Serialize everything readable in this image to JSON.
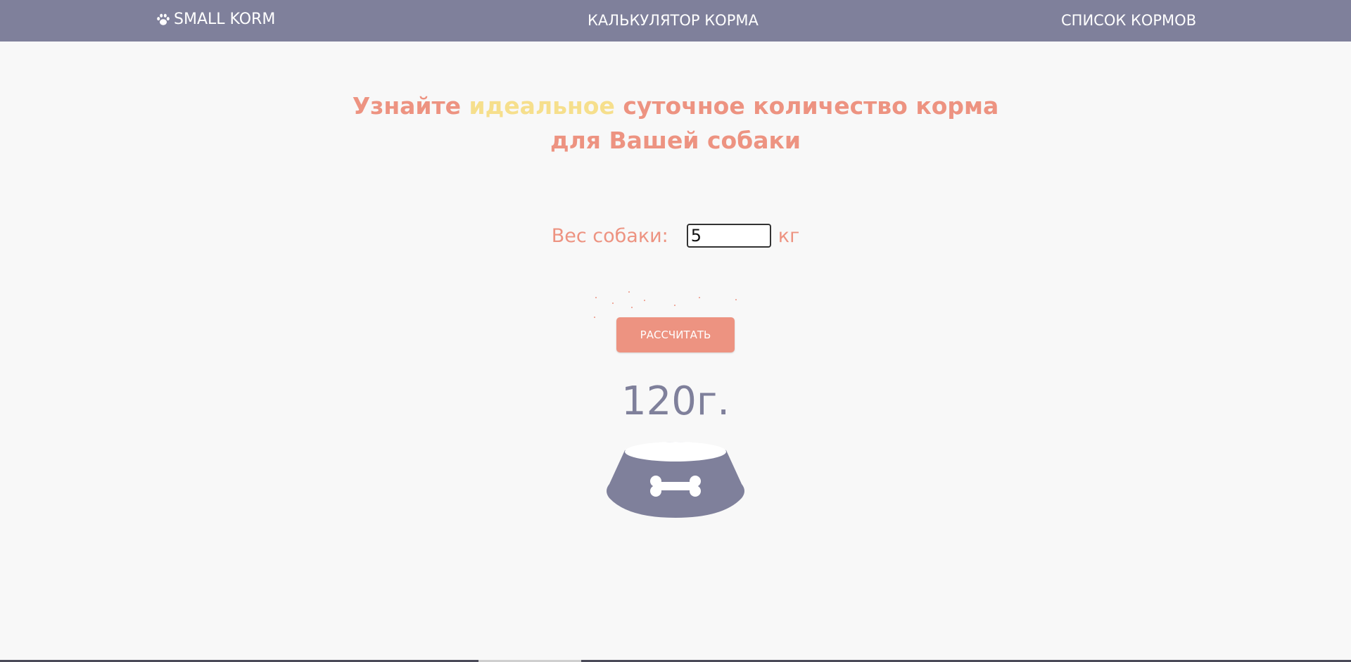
{
  "nav": {
    "logo_text": "SMALL KORM",
    "calculator_link": "КАЛЬКУЛЯТОР КОРМА",
    "list_link": "СПИСОК КОРМОВ"
  },
  "headline": {
    "part1": "Узнайте ",
    "accent": "идеальное",
    "part2": " суточное количество корма",
    "line2": "для Вашей собаки"
  },
  "form": {
    "weight_label": "Вес собаки:",
    "weight_value": "5",
    "weight_unit": "кг",
    "button_label": "РАССЧИТАТЬ"
  },
  "result": {
    "amount": "120г."
  },
  "colors": {
    "nav_bg": "#7f809b",
    "accent_salmon": "#ed9381",
    "accent_yellow": "#f6df8c",
    "page_bg": "#f8f8f8"
  },
  "icons": [
    "paw-icon",
    "dog-bowl-icon",
    "bone-icon"
  ]
}
